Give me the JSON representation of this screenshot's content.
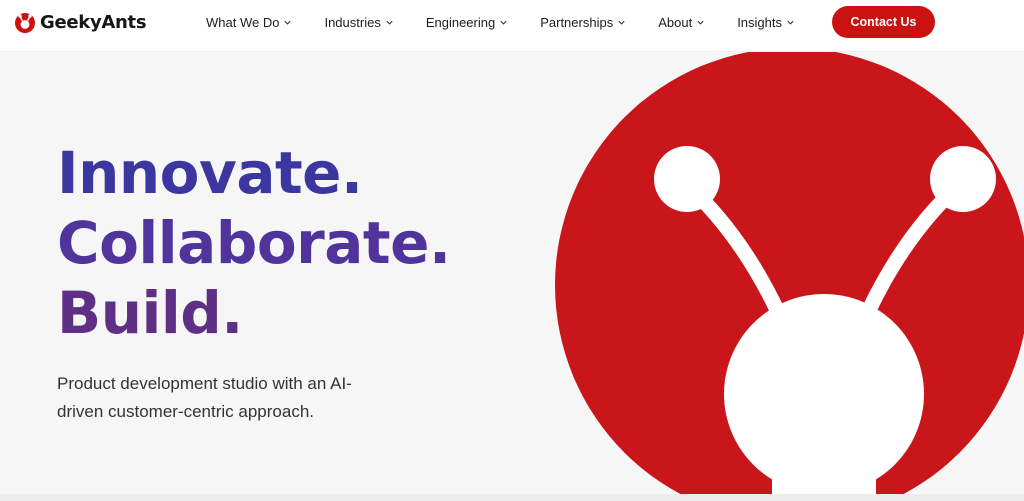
{
  "brand": {
    "name": "GeekyAnts",
    "color": "#cc1111"
  },
  "nav": {
    "items": [
      {
        "label": "What We Do",
        "icon": "chevron-down-icon"
      },
      {
        "label": "Industries",
        "icon": "chevron-down-icon"
      },
      {
        "label": "Engineering",
        "icon": "chevron-down-icon"
      },
      {
        "label": "Partnerships",
        "icon": "chevron-down-icon"
      },
      {
        "label": "About",
        "icon": "chevron-down-icon"
      },
      {
        "label": "Insights",
        "icon": "chevron-down-icon"
      }
    ],
    "cta_label": "Contact Us"
  },
  "hero": {
    "headline": [
      "Innovate.",
      "Collaborate.",
      "Build."
    ],
    "subtitle_lines": [
      "Product development studio with an AI-",
      "driven customer-centric approach."
    ],
    "illustration": "ant-mascot",
    "colors": {
      "headline_start": "#3b36a0",
      "headline_end": "#5e2f85",
      "illustration_red": "#c8161a",
      "background": "#f6f6f6"
    }
  }
}
